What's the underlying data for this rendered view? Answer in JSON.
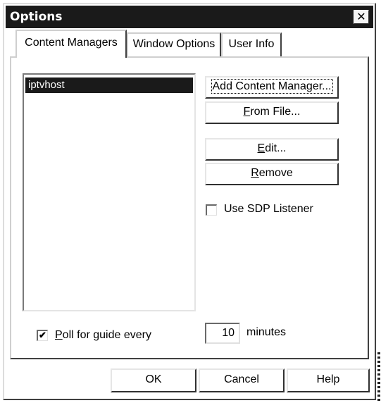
{
  "window": {
    "title": "Options",
    "close_glyph": "✕"
  },
  "tabs": [
    {
      "label": "Content Managers",
      "active": true
    },
    {
      "label": "Window Options",
      "active": false
    },
    {
      "label": "User Info",
      "active": false
    }
  ],
  "content_managers": {
    "list_items": [
      "iptvhost"
    ],
    "selected_item": "iptvhost",
    "buttons": {
      "add": "Add Content Manager...",
      "from_file_mn": "F",
      "from_file_rest": "rom File...",
      "edit_mn": "E",
      "edit_rest": "dit...",
      "remove_mn": "R",
      "remove_rest": "emove"
    },
    "sdp_listener": {
      "label": "Use SDP Listener",
      "checked": false,
      "mark": ""
    },
    "poll": {
      "checked": true,
      "mark": "✔",
      "label_mn": "P",
      "label_rest": "oll for guide every",
      "value": "10",
      "unit": "minutes"
    }
  },
  "footer": {
    "ok": "OK",
    "cancel": "Cancel",
    "help": "Help"
  },
  "figure_id": "200000"
}
